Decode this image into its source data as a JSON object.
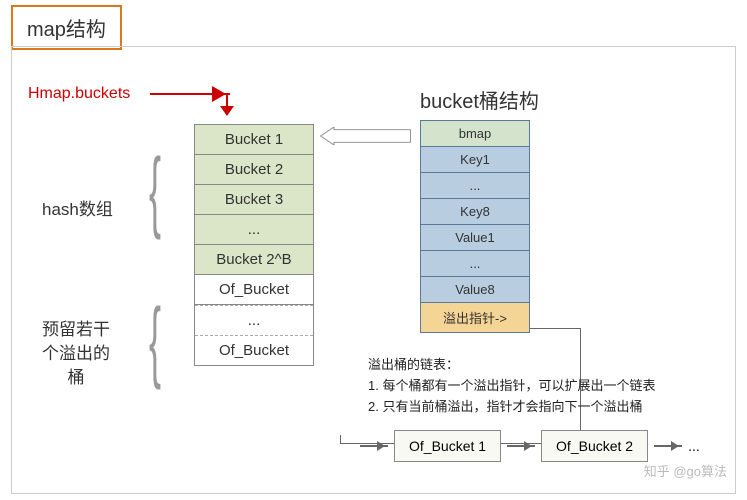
{
  "title": "map结构",
  "hmap_label": "Hmap.buckets",
  "bucket_struct_title": "bucket桶结构",
  "hash_array_label": "hash数组",
  "reserve_label_l1": "预留若干",
  "reserve_label_l2": "个溢出的",
  "reserve_label_l3": "桶",
  "buckets": {
    "b1": "Bucket 1",
    "b2": "Bucket 2",
    "b3": "Bucket 3",
    "dots": "...",
    "blast": "Bucket 2^B",
    "of1": "Of_Bucket",
    "of_dots": "...",
    "of2": "Of_Bucket"
  },
  "bmap": {
    "header": "bmap",
    "key1": "Key1",
    "kdots": "...",
    "key8": "Key8",
    "val1": "Value1",
    "vdots": "...",
    "val8": "Value8",
    "overflow": "溢出指针->"
  },
  "overflow_chain": {
    "title": "溢出桶的链表：",
    "line1": "1. 每个桶都有一个溢出指针，可以扩展出一个链表",
    "line2": "2. 只有当前桶溢出，指针才会指向下一个溢出桶",
    "box1": "Of_Bucket 1",
    "box2": "Of_Bucket 2",
    "tail": "..."
  },
  "watermark": "知乎 @go算法"
}
